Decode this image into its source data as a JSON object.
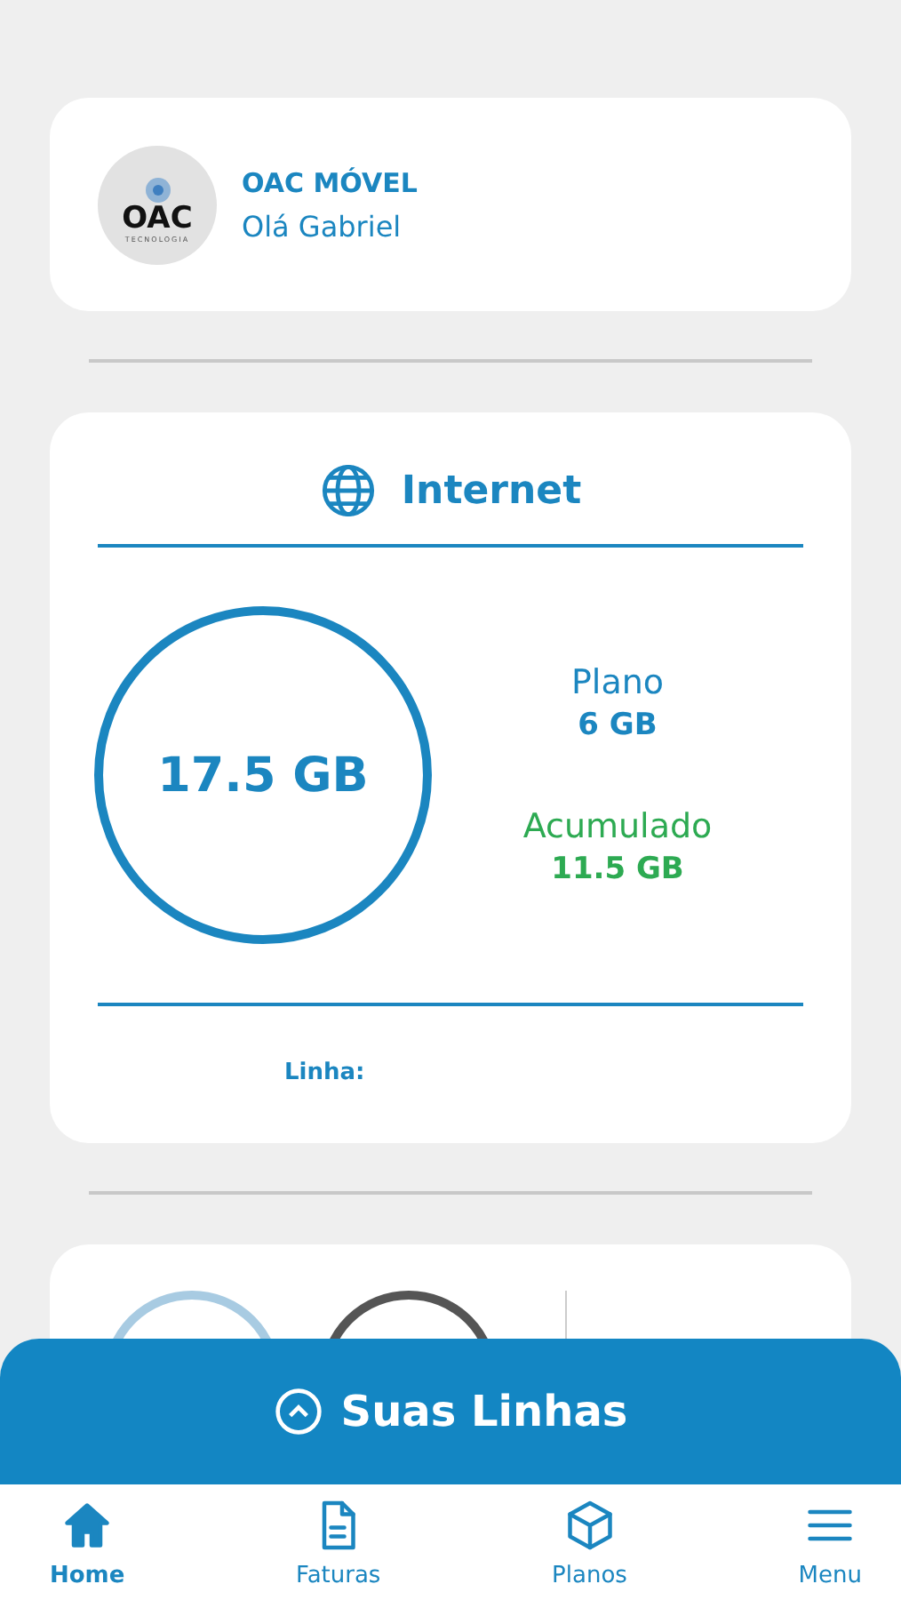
{
  "profile": {
    "logo_text": "OAC",
    "logo_subtext": "TECNOLOGIA",
    "brand": "OAC MÓVEL",
    "greeting": "Olá Gabriel"
  },
  "internet": {
    "title": "Internet",
    "total": "17.5 GB",
    "plan_label": "Plano",
    "plan_value": "6 GB",
    "accumulated_label": "Acumulado",
    "accumulated_value": "11.5 GB",
    "line_label": "Linha:"
  },
  "sheet": {
    "title": "Suas Linhas",
    "expanded": false
  },
  "nav": [
    {
      "label": "Home",
      "selected": true
    },
    {
      "label": "Faturas",
      "selected": false
    },
    {
      "label": "Planos",
      "selected": false
    },
    {
      "label": "Menu",
      "selected": false
    }
  ]
}
